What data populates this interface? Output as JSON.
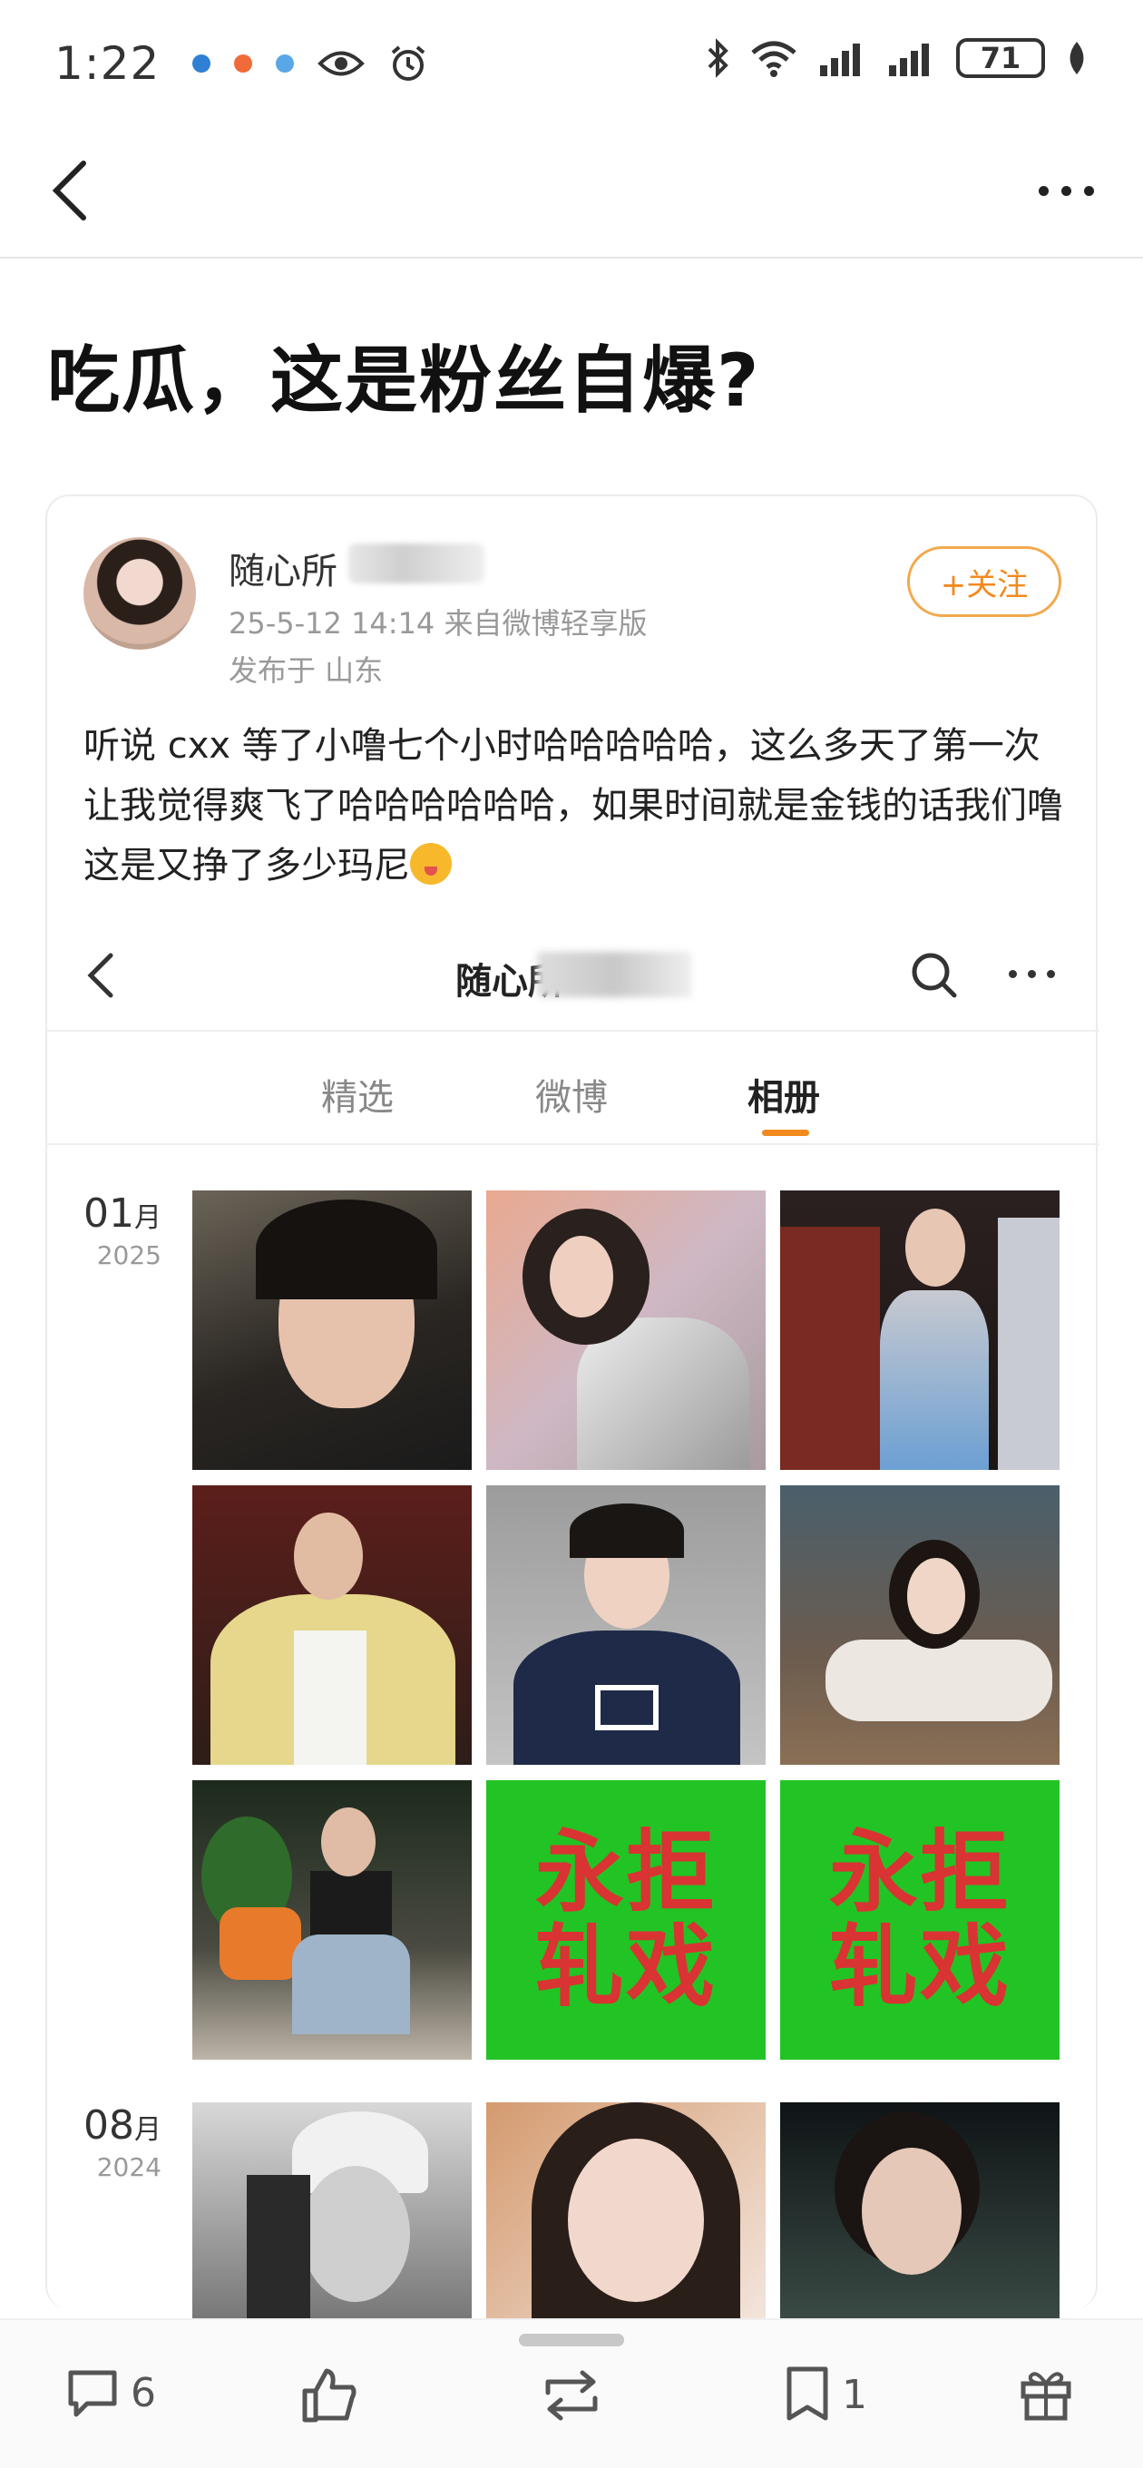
{
  "status": {
    "time": "1:22",
    "battery": "71"
  },
  "article": {
    "title": "吃瓜，这是粉丝自爆?"
  },
  "post": {
    "user_name": "随心所",
    "meta": "25-5-12 14:14  来自微博轻享版",
    "location": "发布于 山东",
    "follow_label": "+关注",
    "text": "听说 cxx 等了小噜七个小时哈哈哈哈哈，这么多天了第一次让我觉得爽飞了哈哈哈哈哈哈，如果时间就是金钱的话我们噜这是又挣了多少玛尼"
  },
  "embedded": {
    "title": "随心所",
    "tabs": [
      {
        "label": "精选"
      },
      {
        "label": "微博"
      },
      {
        "label": "相册"
      }
    ],
    "active_tab": "相册",
    "groups": [
      {
        "month": "01",
        "month_unit": "月",
        "year": "2025"
      },
      {
        "month": "08",
        "month_unit": "月",
        "year": "2024"
      }
    ],
    "banner_text_line1": "永拒",
    "banner_text_line2": "轧戏"
  },
  "actions": {
    "comments": "6",
    "bookmarks": "1"
  },
  "colors": {
    "accent": "#f28a1e",
    "green_banner": "#21c424",
    "banner_text": "#d93333"
  }
}
